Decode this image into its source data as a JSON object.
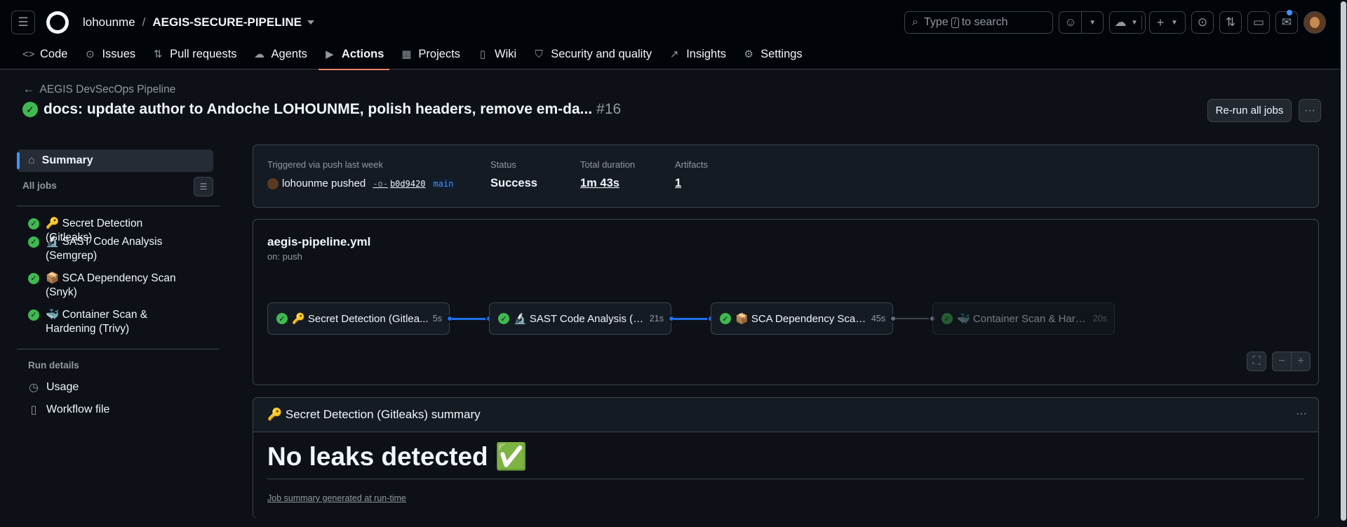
{
  "header": {
    "owner": "lohounme",
    "separator": "/",
    "repo": "AEGIS-SECURE-PIPELINE",
    "search_prefix": "Type",
    "search_key": "/",
    "search_suffix": "to search"
  },
  "tabs": [
    {
      "label": "Code",
      "icon": "code-icon"
    },
    {
      "label": "Issues",
      "icon": "issue-icon"
    },
    {
      "label": "Pull requests",
      "icon": "pull-request-icon"
    },
    {
      "label": "Agents",
      "icon": "agents-icon"
    },
    {
      "label": "Actions",
      "icon": "play-icon"
    },
    {
      "label": "Projects",
      "icon": "table-icon"
    },
    {
      "label": "Wiki",
      "icon": "book-icon"
    },
    {
      "label": "Security and quality",
      "icon": "shield-icon"
    },
    {
      "label": "Insights",
      "icon": "graph-icon"
    },
    {
      "label": "Settings",
      "icon": "gear-icon"
    }
  ],
  "run": {
    "back_label": "AEGIS DevSecOps Pipeline",
    "title": "docs: update author to Andoche LOHOUNME, polish headers, remove em-da...",
    "number": "#16",
    "rerun_label": "Re-run all jobs"
  },
  "sidebar": {
    "summary_label": "Summary",
    "all_jobs_label": "All jobs",
    "jobs": [
      "🔑 Secret Detection (Gitleaks)",
      "🔬 SAST Code Analysis (Semgrep)",
      "📦 SCA Dependency Scan (Snyk)",
      "🐳 Container Scan & Hardening (Trivy)"
    ],
    "run_details_label": "Run details",
    "usage_label": "Usage",
    "workflow_file_label": "Workflow file"
  },
  "info": {
    "trigger_label": "Triggered via push last week",
    "actor": "lohounme pushed",
    "sha": "b0d9420",
    "branch": "main",
    "status_label": "Status",
    "status_value": "Success",
    "duration_label": "Total duration",
    "duration_value": "1m 43s",
    "artifacts_label": "Artifacts",
    "artifacts_value": "1"
  },
  "graph": {
    "workflow_name": "aegis-pipeline.yml",
    "trigger": "on: push",
    "nodes": [
      {
        "label": "🔑 Secret Detection (Gitlea...",
        "duration": "5s"
      },
      {
        "label": "🔬 SAST Code Analysis (Se...",
        "duration": "21s"
      },
      {
        "label": "📦 SCA Dependency Scan (...",
        "duration": "45s"
      },
      {
        "label": "🐳 Container Scan & Hard...",
        "duration": "20s"
      }
    ]
  },
  "summary": {
    "heading": "🔑 Secret Detection (Gitleaks) summary",
    "big_text": "No leaks detected ✅",
    "footer": "Job summary generated at run-time"
  }
}
